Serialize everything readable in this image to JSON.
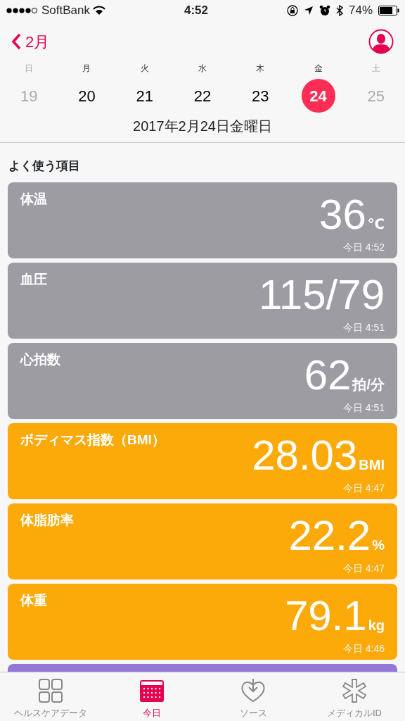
{
  "status_bar": {
    "carrier": "SoftBank",
    "time": "4:52",
    "battery": "74%"
  },
  "nav": {
    "back": "2月"
  },
  "week": [
    {
      "weekday": "日",
      "date": "19",
      "dimmed": true,
      "selected": false
    },
    {
      "weekday": "月",
      "date": "20",
      "dimmed": false,
      "selected": false
    },
    {
      "weekday": "火",
      "date": "21",
      "dimmed": false,
      "selected": false
    },
    {
      "weekday": "水",
      "date": "22",
      "dimmed": false,
      "selected": false
    },
    {
      "weekday": "木",
      "date": "23",
      "dimmed": false,
      "selected": false
    },
    {
      "weekday": "金",
      "date": "24",
      "dimmed": false,
      "selected": true
    },
    {
      "weekday": "土",
      "date": "25",
      "dimmed": true,
      "selected": false
    }
  ],
  "full_date": "2017年2月24日金曜日",
  "section_title": "よく使う項目",
  "cards": [
    {
      "title": "体温",
      "value": "36",
      "unit": "℃",
      "time": "今日 4:52",
      "color": "#9d9ca2"
    },
    {
      "title": "血圧",
      "value": "115/79",
      "time": "今日 4:51",
      "color": "#9d9ca2"
    },
    {
      "title": "心拍数",
      "value": "62",
      "unit": "拍/分",
      "time": "今日 4:51",
      "color": "#9d9ca2"
    },
    {
      "title": "ボディマス指数（BMI）",
      "value": "28.03",
      "unit": "BMI",
      "time": "今日 4:47",
      "color": "#fbaa0a"
    },
    {
      "title": "体脂肪率",
      "value": "22.2",
      "unit": "%",
      "time": "今日 4:47",
      "color": "#fbaa0a"
    },
    {
      "title": "体重",
      "value": "79.1",
      "unit": "kg",
      "time": "今日 4:46",
      "color": "#fbaa0a"
    },
    {
      "color": "#9378d8"
    }
  ],
  "tabs": [
    {
      "label": "ヘルスケアデータ",
      "selected": false
    },
    {
      "label": "今日",
      "selected": true
    },
    {
      "label": "ソース",
      "selected": false
    },
    {
      "label": "メディカルID",
      "selected": false
    }
  ]
}
